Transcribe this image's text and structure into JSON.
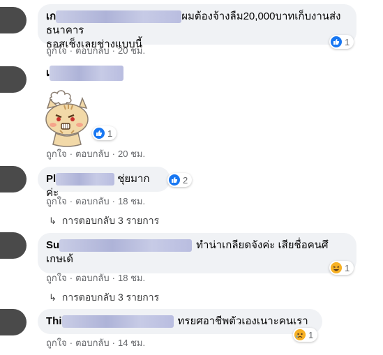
{
  "comments": [
    {
      "name": "เก",
      "text_line1": "ผมต้องจ้างลืม20,000บาทเก็บงานส่งธนาคาร",
      "text_line2": "ธอสเช็งเลยช่างแบบนี้",
      "reaction_count": "1",
      "reaction_type": "like-icon",
      "like_label": "ถูกใจ",
      "reply_label": "ตอบกลับ",
      "time": "20 ชม."
    },
    {
      "name": "เ",
      "reaction_count": "1",
      "reaction_type": "like-icon",
      "like_label": "ถูกใจ",
      "reply_label": "ตอบกลับ",
      "time": "20 ชม."
    },
    {
      "name": "Pl",
      "text": "ชุ่ยมากค่ะ",
      "reaction_count": "2",
      "reaction_type": "like-icon",
      "like_label": "ถูกใจ",
      "reply_label": "ตอบกลับ",
      "time": "18 ชม.",
      "replies_label": "การตอบกลับ 3 รายการ"
    },
    {
      "name": "Su",
      "text_line1": "ทำน่าเกลียดจังค่ะ เสียชื่อคนศึ",
      "text_line2": "เกษเด้",
      "reaction_count": "1",
      "reaction_type": "haha-icon",
      "like_label": "ถูกใจ",
      "reply_label": "ตอบกลับ",
      "time": "18 ชม.",
      "replies_label": "การตอบกลับ 3 รายการ"
    },
    {
      "name": "Thi",
      "text": "ทรยศอาชีพตัวเองเนาะคนเรา",
      "reaction_count": "1",
      "reaction_type": "sad-icon",
      "like_label": "ถูกใจ",
      "reply_label": "ตอบกลับ",
      "time": "14 ชม."
    }
  ],
  "colors": {
    "bubble": "#f0f2f5",
    "like_blue": "#1877f2",
    "meta_gray": "#65676b",
    "emoji_yellow": "#f7b125"
  }
}
